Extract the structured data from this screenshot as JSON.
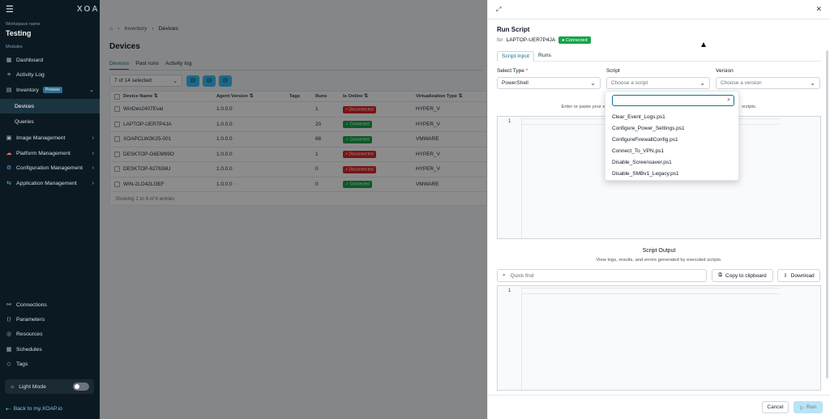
{
  "sidebar": {
    "workspace_label": "Workspace name",
    "workspace": "Testing",
    "brand": "XOAP",
    "modules_label": "Modules",
    "items": [
      {
        "label": "Dashboard",
        "icon": "grid-icon"
      },
      {
        "label": "Activity Log",
        "icon": "list-icon"
      },
      {
        "label": "Inventory",
        "icon": "inventory-icon",
        "badge": "Preview"
      },
      {
        "label": "Devices"
      },
      {
        "label": "Queries"
      },
      {
        "label": "Image Management",
        "icon": "image-icon"
      },
      {
        "label": "Platform Management",
        "icon": "cloud-icon"
      },
      {
        "label": "Configuration Management",
        "icon": "settings-icon"
      },
      {
        "label": "Application Management",
        "icon": "app-icon"
      }
    ],
    "bottom": [
      {
        "label": "Connections"
      },
      {
        "label": "Parameters"
      },
      {
        "label": "Resources"
      },
      {
        "label": "Schedules"
      },
      {
        "label": "Tags"
      }
    ],
    "light_mode": "Light Mode",
    "back": "Back to my.XOAP.io"
  },
  "main": {
    "breadcrumb": [
      "Inventory",
      "Devices"
    ],
    "title": "Devices",
    "tabs": [
      "Devices",
      "Past runs",
      "Activity log"
    ],
    "selected": "7 of 14 selected",
    "columns": [
      "Device Name",
      "Agent Version",
      "Tags",
      "Runs",
      "Is Online",
      "Virtualization Type"
    ],
    "rows": [
      {
        "name": "WinDev2407Eval",
        "ver": "1.0.0.0",
        "runs": "1",
        "online": "Disconnected",
        "virt": "HYPER_V"
      },
      {
        "name": "LAPTOP-UER7P4JA",
        "ver": "1.0.0.0",
        "runs": "20",
        "online": "Connected",
        "virt": "HYPER_V"
      },
      {
        "name": "XOAPCLW2K25-001",
        "ver": "1.0.0.0",
        "runs": "68",
        "online": "Connected",
        "virt": "VMWARE"
      },
      {
        "name": "DESKTOP-G6EM99O",
        "ver": "1.0.0.0",
        "runs": "1",
        "online": "Disconnected",
        "virt": "HYPER_V"
      },
      {
        "name": "DESKTOP-627636U",
        "ver": "1.0.0.0",
        "runs": "0",
        "online": "Disconnected",
        "virt": "HYPER_V"
      },
      {
        "name": "WIN-2LO42LI3EF",
        "ver": "1.0.0.0",
        "runs": "0",
        "online": "Connected",
        "virt": "VMWARE"
      }
    ],
    "footer": "Showing 1 to 6 of 6 entries"
  },
  "panel": {
    "title": "Run Script",
    "for_label": "for",
    "host": "LAPTOP-UER7P4JA",
    "status": "Connected",
    "tabs": [
      "Script input",
      "Runs"
    ],
    "select_type_label": "Select Type",
    "select_type_value": "PowerShell",
    "script_label": "Script",
    "script_placeholder": "Choose a script",
    "version_label": "Version",
    "version_placeholder": "Choose a version",
    "hint_left": "Enter or paste your sc",
    "hint_right": "scripts.",
    "line_no": "1",
    "output_title": "Script Output",
    "output_sub": "View logs, results, and errors generated by executed scripts.",
    "quick_find": "Quick find",
    "copy": "Copy to clipboard",
    "download": "Download",
    "cancel": "Cancel",
    "run": "Run",
    "dropdown": [
      "Clear_Event_Logs.ps1",
      "Configure_Power_Settings.ps1",
      "ConfigureFirewallConfig.ps1",
      "Connect_To_VPN.ps1",
      "Disable_Screensaver.ps1",
      "Disable_SMBv1_Legacy.ps1"
    ]
  }
}
